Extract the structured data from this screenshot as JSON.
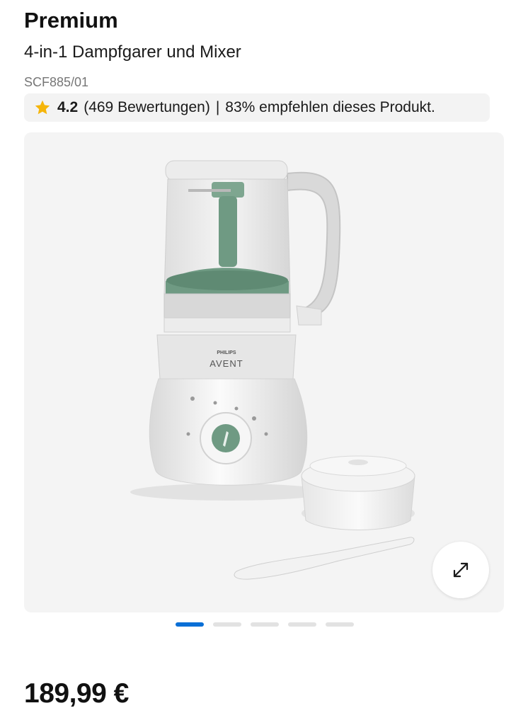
{
  "product": {
    "badge": "Premium",
    "name": "4-in-1 Dampfgarer und Mixer",
    "model": "SCF885/01"
  },
  "rating": {
    "score": "4.2",
    "count_text": "(469 Bewertungen)",
    "separator": "|",
    "recommend_text": "83% empfehlen dieses Produkt."
  },
  "gallery": {
    "brand_top": "PHILIPS",
    "brand_main": "AVENT",
    "image_count": 5,
    "active_index": 0,
    "expand_icon": "expand-arrows-icon"
  },
  "price": "189,99 €",
  "colors": {
    "star": "#f5b50a",
    "active_dot": "#0a6fd6",
    "inactive_dot": "#e2e2e2",
    "appliance_green": "#6f9a83"
  }
}
